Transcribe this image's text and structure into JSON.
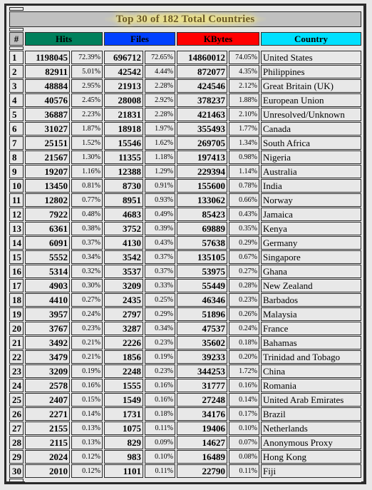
{
  "title": "Top 30 of 182 Total Countries",
  "colors": {
    "hits": "#00805c",
    "files": "#0040ff",
    "kbytes": "#ff0000",
    "country": "#00e0ff",
    "title_bg": "#c0c0c0",
    "title_text": "#6b5a2a"
  },
  "headers": {
    "num": "#",
    "hits": "Hits",
    "files": "Files",
    "kbytes": "KBytes",
    "country": "Country"
  },
  "rows": [
    {
      "n": "1",
      "hits": "1198045",
      "hits_pct": "72.39%",
      "files": "696712",
      "files_pct": "72.65%",
      "kbytes": "14860012",
      "kbytes_pct": "74.05%",
      "country": "United States"
    },
    {
      "n": "2",
      "hits": "82911",
      "hits_pct": "5.01%",
      "files": "42542",
      "files_pct": "4.44%",
      "kbytes": "872077",
      "kbytes_pct": "4.35%",
      "country": "Philippines"
    },
    {
      "n": "3",
      "hits": "48884",
      "hits_pct": "2.95%",
      "files": "21913",
      "files_pct": "2.28%",
      "kbytes": "424546",
      "kbytes_pct": "2.12%",
      "country": "Great Britain (UK)"
    },
    {
      "n": "4",
      "hits": "40576",
      "hits_pct": "2.45%",
      "files": "28008",
      "files_pct": "2.92%",
      "kbytes": "378237",
      "kbytes_pct": "1.88%",
      "country": "European Union"
    },
    {
      "n": "5",
      "hits": "36887",
      "hits_pct": "2.23%",
      "files": "21831",
      "files_pct": "2.28%",
      "kbytes": "421463",
      "kbytes_pct": "2.10%",
      "country": "Unresolved/Unknown"
    },
    {
      "n": "6",
      "hits": "31027",
      "hits_pct": "1.87%",
      "files": "18918",
      "files_pct": "1.97%",
      "kbytes": "355493",
      "kbytes_pct": "1.77%",
      "country": "Canada"
    },
    {
      "n": "7",
      "hits": "25151",
      "hits_pct": "1.52%",
      "files": "15546",
      "files_pct": "1.62%",
      "kbytes": "269705",
      "kbytes_pct": "1.34%",
      "country": "South Africa"
    },
    {
      "n": "8",
      "hits": "21567",
      "hits_pct": "1.30%",
      "files": "11355",
      "files_pct": "1.18%",
      "kbytes": "197413",
      "kbytes_pct": "0.98%",
      "country": "Nigeria"
    },
    {
      "n": "9",
      "hits": "19207",
      "hits_pct": "1.16%",
      "files": "12388",
      "files_pct": "1.29%",
      "kbytes": "229394",
      "kbytes_pct": "1.14%",
      "country": "Australia"
    },
    {
      "n": "10",
      "hits": "13450",
      "hits_pct": "0.81%",
      "files": "8730",
      "files_pct": "0.91%",
      "kbytes": "155600",
      "kbytes_pct": "0.78%",
      "country": "India"
    },
    {
      "n": "11",
      "hits": "12802",
      "hits_pct": "0.77%",
      "files": "8951",
      "files_pct": "0.93%",
      "kbytes": "133062",
      "kbytes_pct": "0.66%",
      "country": "Norway"
    },
    {
      "n": "12",
      "hits": "7922",
      "hits_pct": "0.48%",
      "files": "4683",
      "files_pct": "0.49%",
      "kbytes": "85423",
      "kbytes_pct": "0.43%",
      "country": "Jamaica"
    },
    {
      "n": "13",
      "hits": "6361",
      "hits_pct": "0.38%",
      "files": "3752",
      "files_pct": "0.39%",
      "kbytes": "69889",
      "kbytes_pct": "0.35%",
      "country": "Kenya"
    },
    {
      "n": "14",
      "hits": "6091",
      "hits_pct": "0.37%",
      "files": "4130",
      "files_pct": "0.43%",
      "kbytes": "57638",
      "kbytes_pct": "0.29%",
      "country": "Germany"
    },
    {
      "n": "15",
      "hits": "5552",
      "hits_pct": "0.34%",
      "files": "3542",
      "files_pct": "0.37%",
      "kbytes": "135105",
      "kbytes_pct": "0.67%",
      "country": "Singapore"
    },
    {
      "n": "16",
      "hits": "5314",
      "hits_pct": "0.32%",
      "files": "3537",
      "files_pct": "0.37%",
      "kbytes": "53975",
      "kbytes_pct": "0.27%",
      "country": "Ghana"
    },
    {
      "n": "17",
      "hits": "4903",
      "hits_pct": "0.30%",
      "files": "3209",
      "files_pct": "0.33%",
      "kbytes": "55449",
      "kbytes_pct": "0.28%",
      "country": "New Zealand"
    },
    {
      "n": "18",
      "hits": "4410",
      "hits_pct": "0.27%",
      "files": "2435",
      "files_pct": "0.25%",
      "kbytes": "46346",
      "kbytes_pct": "0.23%",
      "country": "Barbados"
    },
    {
      "n": "19",
      "hits": "3957",
      "hits_pct": "0.24%",
      "files": "2797",
      "files_pct": "0.29%",
      "kbytes": "51896",
      "kbytes_pct": "0.26%",
      "country": "Malaysia"
    },
    {
      "n": "20",
      "hits": "3767",
      "hits_pct": "0.23%",
      "files": "3287",
      "files_pct": "0.34%",
      "kbytes": "47537",
      "kbytes_pct": "0.24%",
      "country": "France"
    },
    {
      "n": "21",
      "hits": "3492",
      "hits_pct": "0.21%",
      "files": "2226",
      "files_pct": "0.23%",
      "kbytes": "35602",
      "kbytes_pct": "0.18%",
      "country": "Bahamas"
    },
    {
      "n": "22",
      "hits": "3479",
      "hits_pct": "0.21%",
      "files": "1856",
      "files_pct": "0.19%",
      "kbytes": "39233",
      "kbytes_pct": "0.20%",
      "country": "Trinidad and Tobago"
    },
    {
      "n": "23",
      "hits": "3209",
      "hits_pct": "0.19%",
      "files": "2248",
      "files_pct": "0.23%",
      "kbytes": "344253",
      "kbytes_pct": "1.72%",
      "country": "China"
    },
    {
      "n": "24",
      "hits": "2578",
      "hits_pct": "0.16%",
      "files": "1555",
      "files_pct": "0.16%",
      "kbytes": "31777",
      "kbytes_pct": "0.16%",
      "country": "Romania"
    },
    {
      "n": "25",
      "hits": "2407",
      "hits_pct": "0.15%",
      "files": "1549",
      "files_pct": "0.16%",
      "kbytes": "27248",
      "kbytes_pct": "0.14%",
      "country": "United Arab Emirates"
    },
    {
      "n": "26",
      "hits": "2271",
      "hits_pct": "0.14%",
      "files": "1731",
      "files_pct": "0.18%",
      "kbytes": "34176",
      "kbytes_pct": "0.17%",
      "country": "Brazil"
    },
    {
      "n": "27",
      "hits": "2155",
      "hits_pct": "0.13%",
      "files": "1075",
      "files_pct": "0.11%",
      "kbytes": "19406",
      "kbytes_pct": "0.10%",
      "country": "Netherlands"
    },
    {
      "n": "28",
      "hits": "2115",
      "hits_pct": "0.13%",
      "files": "829",
      "files_pct": "0.09%",
      "kbytes": "14627",
      "kbytes_pct": "0.07%",
      "country": "Anonymous Proxy"
    },
    {
      "n": "29",
      "hits": "2024",
      "hits_pct": "0.12%",
      "files": "983",
      "files_pct": "0.10%",
      "kbytes": "16489",
      "kbytes_pct": "0.08%",
      "country": "Hong Kong"
    },
    {
      "n": "30",
      "hits": "2010",
      "hits_pct": "0.12%",
      "files": "1101",
      "files_pct": "0.11%",
      "kbytes": "22790",
      "kbytes_pct": "0.11%",
      "country": "Fiji"
    }
  ]
}
